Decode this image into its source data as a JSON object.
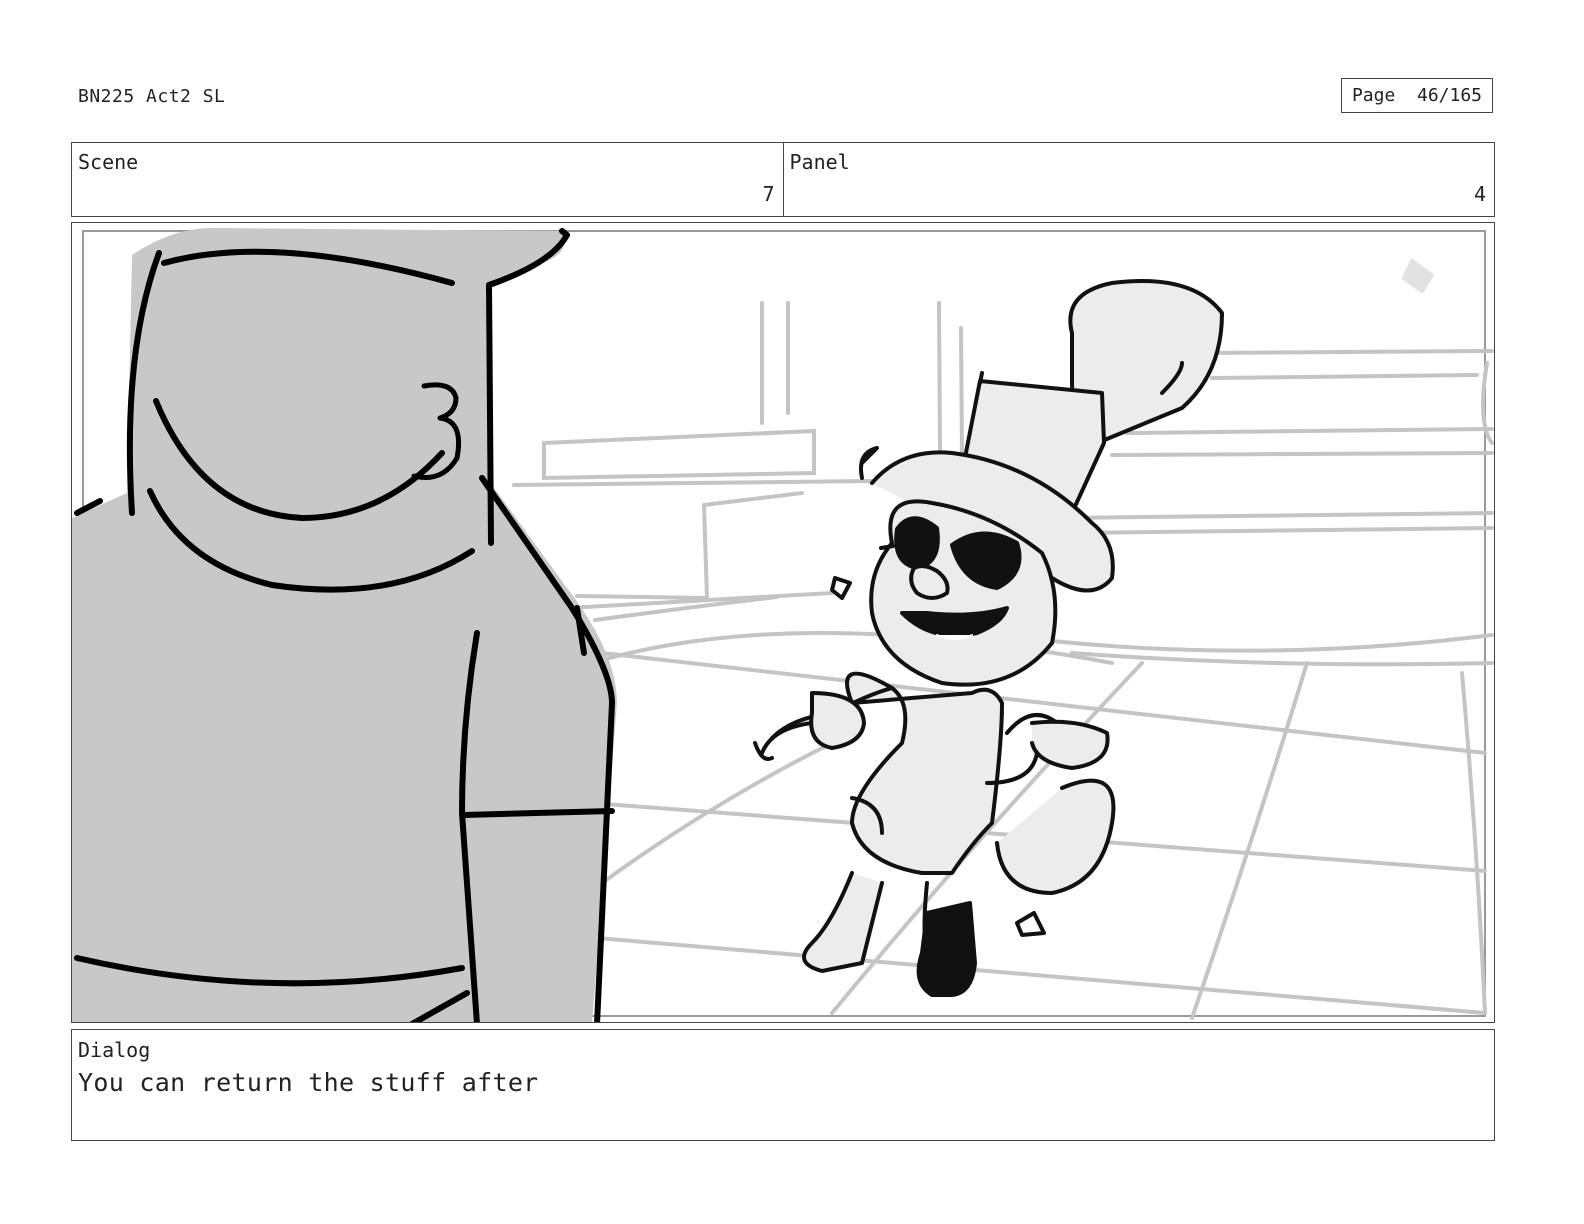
{
  "header": {
    "doc_title": "BN225 Act2 SL",
    "page_label": "Page",
    "page_number": "46/165"
  },
  "info": {
    "scene_label": "Scene",
    "scene_value": "7",
    "panel_label": "Panel",
    "panel_value": "4"
  },
  "dialog": {
    "label": "Dialog",
    "text": "You can return the stuff after"
  }
}
